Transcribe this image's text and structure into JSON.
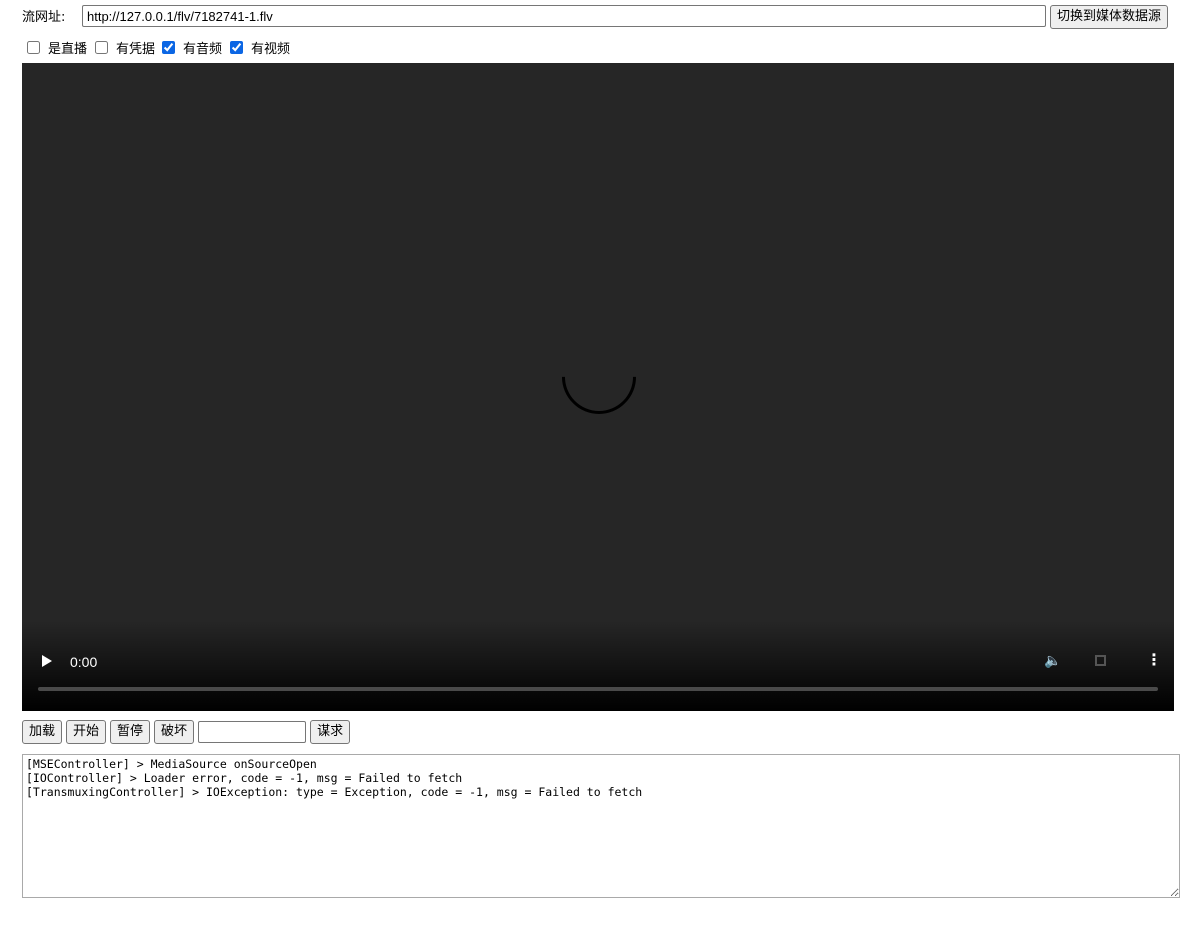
{
  "header": {
    "url_label": "流网址:",
    "url_value": "http://127.0.0.1/flv/7182741-1.flv",
    "switch_label": "切换到媒体数据源"
  },
  "options": [
    {
      "label": "是直播",
      "checked": false
    },
    {
      "label": "有凭据",
      "checked": false
    },
    {
      "label": "有音频",
      "checked": true
    },
    {
      "label": "有视频",
      "checked": true
    }
  ],
  "video": {
    "time": "0:00",
    "progress": 0,
    "icons": [
      "play-icon",
      "volume-icon",
      "fullscreen-icon",
      "more-icon"
    ]
  },
  "controls": {
    "load": "加载",
    "start": "开始",
    "pause": "暂停",
    "destroy": "破坏",
    "seek_value": "",
    "seek": "谋求"
  },
  "log": {
    "text": "[MSEController] > MediaSource onSourceOpen\n[IOController] > Loader error, code = -1, msg = Failed to fetch\n[TransmuxingController] > IOException: type = Exception, code = -1, msg = Failed to fetch"
  },
  "colors": {
    "accent": "#0b66e4",
    "video_bg": "#262626"
  }
}
